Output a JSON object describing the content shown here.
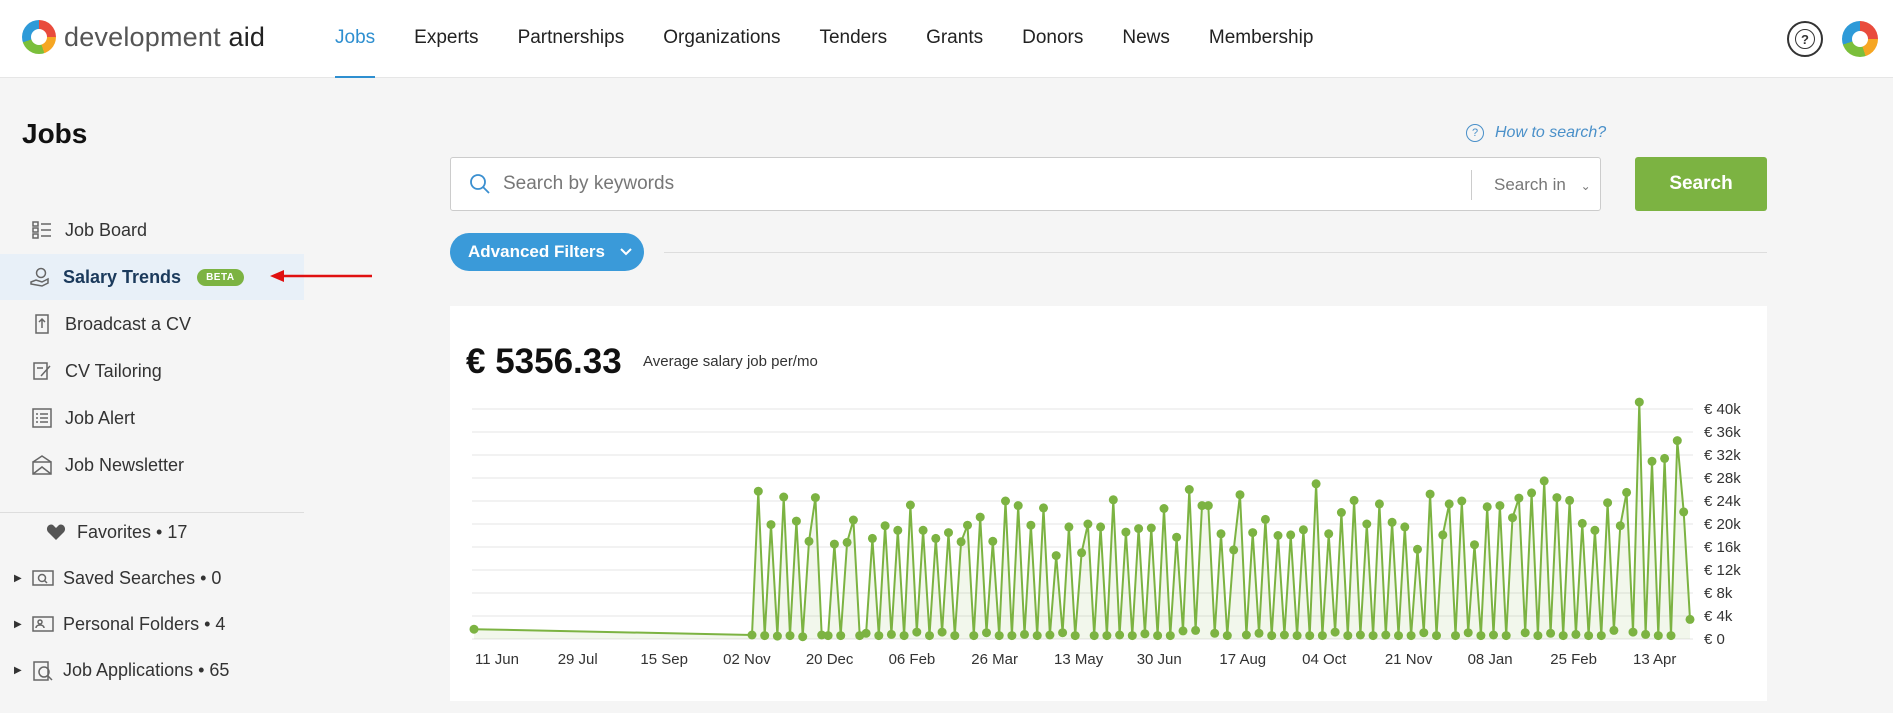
{
  "brand": {
    "name_part1": "development",
    "name_part2": "aid"
  },
  "nav": {
    "items": [
      "Jobs",
      "Experts",
      "Partnerships",
      "Organizations",
      "Tenders",
      "Grants",
      "Donors",
      "News",
      "Membership"
    ],
    "active": "Jobs"
  },
  "header": {
    "help_glyph": "?"
  },
  "sidebar": {
    "title": "Jobs",
    "items": [
      {
        "label": "Job Board",
        "icon": "list-icon"
      },
      {
        "label": "Salary Trends",
        "icon": "salary-icon",
        "badge": "BETA",
        "active": true
      },
      {
        "label": "Broadcast a CV",
        "icon": "upload-icon"
      },
      {
        "label": "CV Tailoring",
        "icon": "edit-icon"
      },
      {
        "label": "Job Alert",
        "icon": "checklist-icon"
      },
      {
        "label": "Job Newsletter",
        "icon": "mail-icon"
      }
    ],
    "secondary": [
      {
        "label": "Favorites • 17",
        "icon": "heart-icon"
      },
      {
        "label": "Saved Searches • 0",
        "icon": "saved-search-icon"
      },
      {
        "label": "Personal Folders • 4",
        "icon": "folder-icon"
      },
      {
        "label": "Job Applications • 65",
        "icon": "application-icon"
      }
    ]
  },
  "search": {
    "help_link": "How to search?",
    "help_glyph": "?",
    "placeholder": "Search by keywords",
    "search_in_label": "Search in",
    "button_label": "Search",
    "advanced_filters_label": "Advanced Filters"
  },
  "summary": {
    "value": "€ 5356.33",
    "label": "Average salary job per/mo"
  },
  "colors": {
    "accent": "#7cb342",
    "link": "#2e8fd0",
    "filter_button": "#3a9ad9"
  },
  "chart_data": {
    "type": "line",
    "x_tick_labels": [
      "11 Jun",
      "29 Jul",
      "15 Sep",
      "02 Nov",
      "20 Dec",
      "06 Feb",
      "26 Mar",
      "13 May",
      "30 Jun",
      "17 Aug",
      "04 Oct",
      "21 Nov",
      "08 Jan",
      "25 Feb",
      "13 Apr"
    ],
    "y_tick_labels": [
      "€ 0",
      "€ 4k",
      "€ 8k",
      "€ 12k",
      "€ 16k",
      "€ 20k",
      "€ 24k",
      "€ 28k",
      "€ 32k",
      "€ 36k",
      "€ 40k"
    ],
    "ylim": [
      0,
      40000
    ],
    "y_axis_position": "right",
    "grid": true,
    "series": [
      {
        "values": [
          1700,
          700,
          25700,
          600,
          19900,
          500,
          24700,
          600,
          20500,
          400,
          17000,
          24600,
          700,
          600,
          16500,
          600,
          16800,
          20700,
          600,
          1000,
          17500,
          600,
          19700,
          800,
          18900,
          600,
          23300,
          1200,
          18900,
          600,
          17500,
          1200,
          18500,
          600,
          16900,
          19800,
          600,
          21200,
          1100,
          17000,
          600,
          24000,
          600,
          23200,
          800,
          19800,
          600,
          22800,
          700,
          14500,
          1100,
          19500,
          600,
          15000,
          20000,
          600,
          19500,
          600,
          24200,
          700,
          18600,
          600,
          19200,
          900,
          19300,
          600,
          22700,
          600,
          17700,
          1400,
          26000,
          1500,
          23200,
          23200,
          1000,
          18300,
          600,
          15500,
          25100,
          700,
          18500,
          1000,
          20800,
          600,
          18000,
          700,
          18100,
          600,
          19000,
          600,
          27000,
          600,
          18300,
          1200,
          22000,
          600,
          24100,
          700,
          20000,
          600,
          23500,
          700,
          20300,
          600,
          19500,
          600,
          15600,
          1100,
          25200,
          600,
          18100,
          23500,
          600,
          24000,
          1100,
          16400,
          600,
          23000,
          700,
          23200,
          600,
          21100,
          24500,
          1100,
          25400,
          600,
          27500,
          1000,
          24600,
          600,
          24100,
          800,
          20100,
          600,
          18900,
          600,
          23700,
          1500,
          19700,
          25500,
          1200,
          41200,
          800,
          30900,
          600,
          31400,
          600,
          34500,
          22100,
          3400
        ]
      }
    ]
  }
}
